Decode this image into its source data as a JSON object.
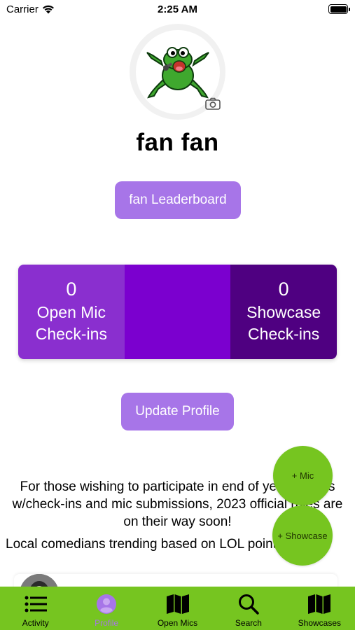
{
  "status_bar": {
    "carrier": "Carrier",
    "time": "2:25 AM"
  },
  "profile": {
    "name": "fan fan"
  },
  "buttons": {
    "leaderboard": "fan Leaderboard",
    "update_profile": "Update Profile"
  },
  "stats": {
    "open_mic_count": "0",
    "open_mic_label_1": "Open Mic",
    "open_mic_label_2": "Check-ins",
    "showcase_count": "0",
    "showcase_label_1": "Showcase",
    "showcase_label_2": "Check-ins"
  },
  "announcement": "For those wishing to participate in end of year awards w/check-ins and mic submissions, 2023 official rules are on their way soon!",
  "trending": "Local comedians trending based on LOL points",
  "fabs": {
    "mic": "+ Mic",
    "showcase": "+ Showcase"
  },
  "tabs": [
    {
      "label": "Activity",
      "icon": "list-icon"
    },
    {
      "label": "Profile",
      "icon": "person-icon"
    },
    {
      "label": "Open Mics",
      "icon": "map-icon"
    },
    {
      "label": "Search",
      "icon": "search-icon"
    },
    {
      "label": "Showcases",
      "icon": "map-icon"
    }
  ],
  "colors": {
    "accent_purple": "#a775e8",
    "tab_bar_green": "#76c520",
    "stat_dark": "#4f0081"
  }
}
